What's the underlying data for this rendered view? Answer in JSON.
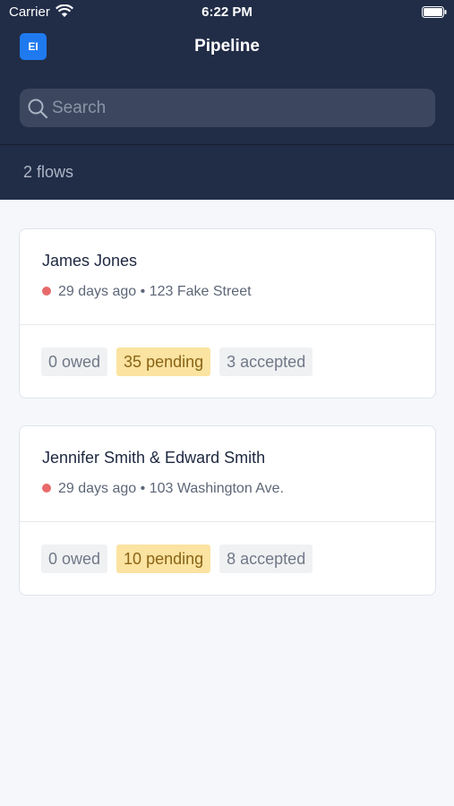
{
  "status_bar": {
    "carrier": "Carrier",
    "time": "6:22 PM"
  },
  "header": {
    "logo_initials": "EI",
    "title": "Pipeline",
    "search_placeholder": "Search",
    "flow_count": "2 flows"
  },
  "colors": {
    "header_bg": "#212c47",
    "logo_bg": "#1f7af0",
    "status_dot": "#e86a6a",
    "pending_bg": "#fbe3a1",
    "pending_text": "#8a6415"
  },
  "flows": [
    {
      "name": "James Jones",
      "age": "29 days ago",
      "address": "123 Fake Street",
      "owed": "0 owed",
      "pending": "35 pending",
      "accepted": "3 accepted"
    },
    {
      "name": "Jennifer Smith & Edward Smith",
      "age": "29 days ago",
      "address": "103 Washington Ave.",
      "owed": "0 owed",
      "pending": "10 pending",
      "accepted": "8 accepted"
    }
  ]
}
